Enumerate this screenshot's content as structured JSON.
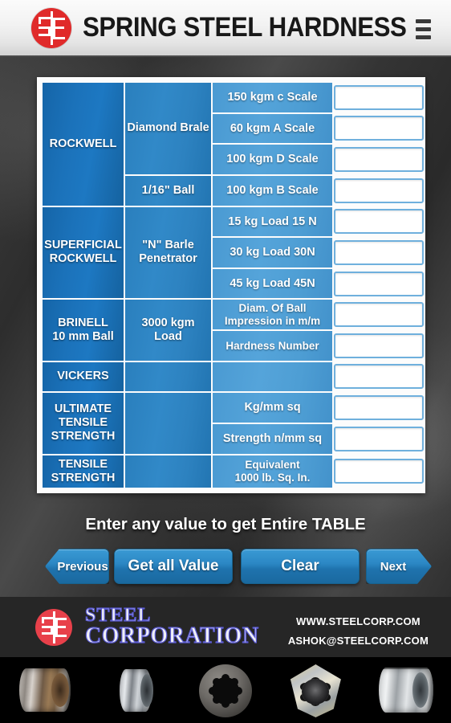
{
  "header": {
    "title": "SPRING STEEL HARDNESS",
    "logo_alt": "SC",
    "menu_icon": "hamburger-menu-icon"
  },
  "table": {
    "rows": [
      {
        "category": "ROCKWELL",
        "category_rowspan": 4,
        "penetrator": "Diamond Brale",
        "penetrator_rowspan": 3,
        "scale": "150 kgm c Scale",
        "value": ""
      },
      {
        "scale": "60 kgm A Scale",
        "value": ""
      },
      {
        "scale": "100 kgm D Scale",
        "value": ""
      },
      {
        "penetrator": "1/16\" Ball",
        "penetrator_rowspan": 1,
        "scale": "100 kgm B Scale",
        "value": ""
      },
      {
        "category": "SUPERFICIAL ROCKWELL",
        "category_rowspan": 3,
        "penetrator": "\"N\" Barle Penetrator",
        "penetrator_rowspan": 3,
        "scale": "15 kg Load 15 N",
        "value": ""
      },
      {
        "scale": "30 kg Load 30N",
        "value": ""
      },
      {
        "scale": "45 kg Load 45N",
        "value": ""
      },
      {
        "category": "BRINELL 10 mm Ball",
        "category_rowspan": 2,
        "penetrator": "3000 kgm Load",
        "penetrator_rowspan": 2,
        "scale": "Diam. Of Ball Impression in m/m",
        "value": ""
      },
      {
        "scale": "Hardness Number",
        "value": ""
      },
      {
        "category": "VICKERS",
        "category_rowspan": 1,
        "penetrator": "",
        "penetrator_rowspan": 1,
        "scale": "",
        "value": ""
      },
      {
        "category": "ULTIMATE TENSILE STRENGTH",
        "category_rowspan": 2,
        "penetrator": "",
        "penetrator_rowspan": 2,
        "scale": "Kg/mm sq",
        "value": ""
      },
      {
        "scale": "Strength n/mm sq",
        "value": ""
      },
      {
        "category": "TENSILE STRENGTH",
        "category_rowspan": 1,
        "penetrator": "",
        "penetrator_rowspan": 1,
        "scale": "Equivalent 1000 lb. Sq. In.",
        "value": ""
      }
    ],
    "categories": {
      "rockwell": "ROCKWELL",
      "superficial_rockwell_l1": "SUPERFICIAL",
      "superficial_rockwell_l2": "ROCKWELL",
      "brinell_l1": "BRINELL",
      "brinell_l2": "10 mm Ball",
      "vickers": "VICKERS",
      "uts_l1": "ULTIMATE",
      "uts_l2": "TENSILE",
      "uts_l3": "STRENGTH",
      "ts_l1": "TENSILE",
      "ts_l2": "STRENGTH"
    },
    "penetrators": {
      "diamond_brale": "Diamond Brale",
      "ball_116": "1/16\" Ball",
      "n_barle_l1": "\"N\" Barle",
      "n_barle_l2": "Penetrator",
      "load3000_l1": "3000 kgm",
      "load3000_l2": "Load"
    },
    "scales": {
      "s150c": "150 kgm c Scale",
      "s60a": "60 kgm A Scale",
      "s100d": "100 kgm D Scale",
      "s100b": "100 kgm B Scale",
      "n15": "15 kg Load 15 N",
      "n30": "30 kg Load 30N",
      "n45": "45 kg Load 45N",
      "diam_l1": "Diam. Of Ball",
      "diam_l2": "Impression in m/m",
      "hardness_number": "Hardness Number",
      "kg_mm_sq": "Kg/mm sq",
      "strength_n_mm_sq": "Strength n/mm sq",
      "equiv_l1": "Equivalent",
      "equiv_l2": "1000 lb. Sq. In."
    },
    "input_placeholder": ""
  },
  "prompt": "Enter any value to get Entire TABLE",
  "buttons": {
    "previous": "Previous",
    "get_all_value": "Get all Value",
    "clear": "Clear",
    "next": "Next"
  },
  "footer": {
    "brand_line1": "STEEL",
    "brand_line2": "CORPORATION",
    "website": "WWW.STEELCORP.COM",
    "email": "ASHOK@STEELCORP.COM",
    "logo_alt": "SC"
  },
  "product_strip": {
    "items": [
      "steel-coil-bronze",
      "slit-steel-coil",
      "toothed-gear-disc",
      "clutch-plate",
      "stacked-steel-coil"
    ]
  },
  "colors": {
    "accent_blue": "#2b87c4",
    "dark_blue": "#1b72ba",
    "light_blue": "#4e9ed4",
    "brand_red": "#e02a2a",
    "background_dark": "#343434"
  }
}
